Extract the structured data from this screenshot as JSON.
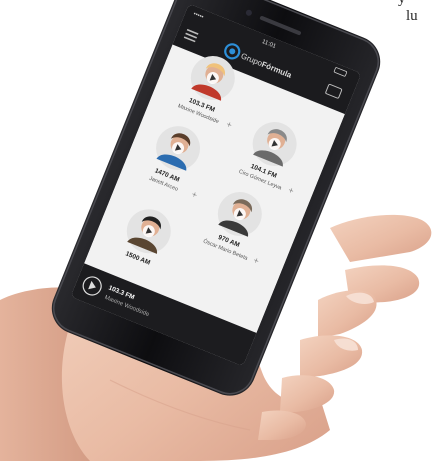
{
  "corner_text": {
    "line1": "y",
    "line2": "lu"
  },
  "phone": {
    "status_bar": {
      "signal": "•••••",
      "time": "11:01"
    },
    "app": {
      "brand_prefix": "Grupo",
      "brand_name": "Fórmula"
    },
    "stations": [
      {
        "frequency": "103.3 FM",
        "host": "Maxine Woodside"
      },
      {
        "frequency": "104.1 FM",
        "host": "Ciro Gómez Leyva"
      },
      {
        "frequency": "1470 AM",
        "host": "Janett Arceo"
      },
      {
        "frequency": "970 AM",
        "host": "Óscar Mario Beteta"
      },
      {
        "frequency": "1500 AM",
        "host": ""
      }
    ],
    "now_playing": {
      "frequency": "103.3 FM",
      "host": "Maxine Woodside"
    }
  },
  "colors": {
    "screen_bg": "#f2f2f2",
    "header_bg": "#1b1b1e",
    "player_bg": "#1c1c1f",
    "brand_blue": "#2d8fd8",
    "phone_body": "#111114"
  }
}
